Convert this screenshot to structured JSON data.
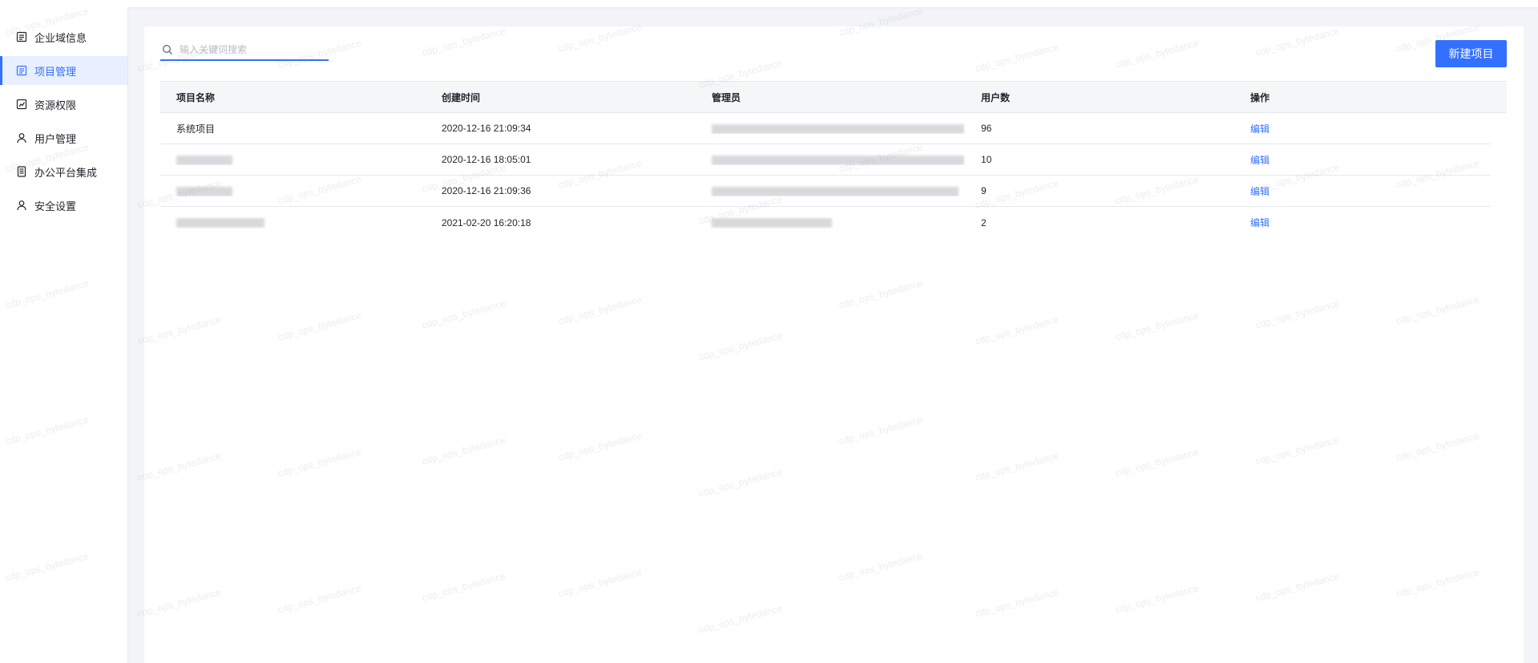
{
  "sidebar": {
    "items": [
      {
        "label": "企业域信息",
        "icon": "list-icon"
      },
      {
        "label": "项目管理",
        "icon": "list-icon",
        "active": true
      },
      {
        "label": "资源权限",
        "icon": "chart-square-icon"
      },
      {
        "label": "用户管理",
        "icon": "user-icon"
      },
      {
        "label": "办公平台集成",
        "icon": "document-icon"
      },
      {
        "label": "安全设置",
        "icon": "user-icon"
      }
    ]
  },
  "search": {
    "placeholder": "输入关键词搜索",
    "value": ""
  },
  "toolbar": {
    "new_project_label": "新建项目"
  },
  "table": {
    "columns": [
      "项目名称",
      "创建时间",
      "管理员",
      "用户数",
      "操作"
    ],
    "rows": [
      {
        "name": "系统项目",
        "created": "2020-12-16 21:09:34",
        "users": "96",
        "action": "编辑"
      },
      {
        "name": "",
        "created": "2020-12-16 18:05:01",
        "users": "10",
        "action": "编辑"
      },
      {
        "name": "",
        "created": "2020-12-16 21:09:36",
        "users": "9",
        "action": "编辑"
      },
      {
        "name": "",
        "created": "2021-02-20 16:20:18",
        "users": "2",
        "action": "编辑"
      }
    ]
  },
  "watermark": {
    "text": "cdp_ops_bytedance"
  },
  "colors": {
    "accent": "#3370ff",
    "active_bg": "#e8f0ff",
    "page_bg": "#f3f4f7"
  }
}
